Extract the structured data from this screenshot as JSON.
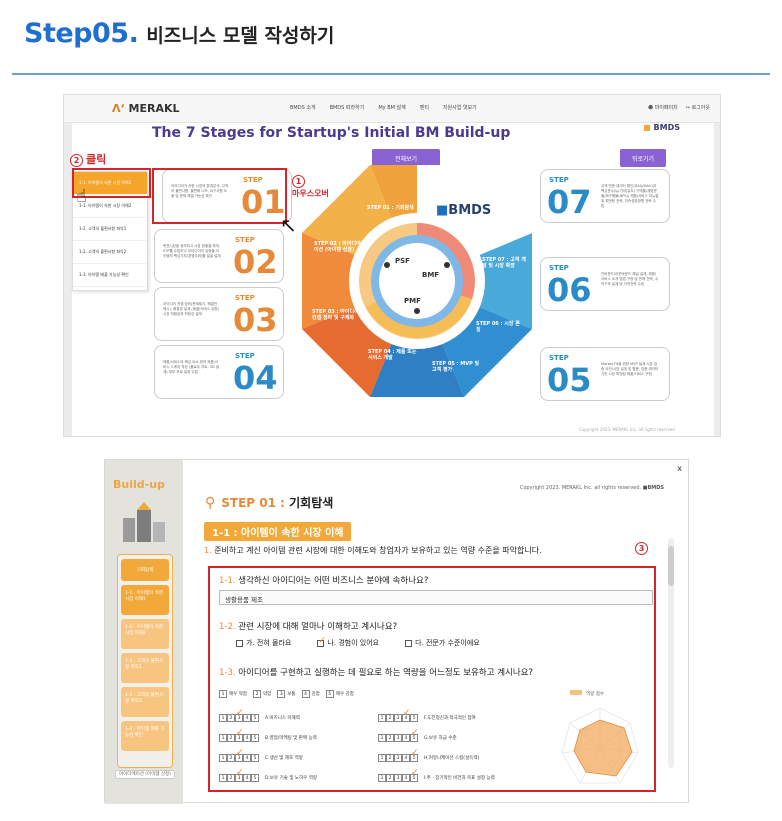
{
  "heading": {
    "step": "Step05.",
    "title": "비즈니스 모델 작성하기"
  },
  "shot1": {
    "logo": "MERAKL",
    "nav": [
      "BMDS 소개",
      "BMDS 따라하기",
      "My BM 설계",
      "멘티",
      "지원사업 엿보기"
    ],
    "nav_right": [
      "마이페이지",
      "로그아웃"
    ],
    "title": "The 7 Stages for Startup's Initial BM Build-up",
    "bmds_top": "BMDS",
    "btn_all": "전체보기",
    "btn_back": "뒤로가기",
    "click_num": "2",
    "click_text": "클릭",
    "side_items": [
      "1-1. 아이템이 속한 시장 이해1",
      "1-1. 아이템이 속한 시장 이해2",
      "1-2. 고객의 불편사항 파악1",
      "1-2. 고객의 불편사항 파악2",
      "1-3. 아이템 매출 가능성 확인"
    ],
    "mouse_num": "1",
    "mouse_text": "마우스오버",
    "cards": [
      {
        "step": "STEP",
        "num": "01",
        "text": "아이디어가 속한 시장의 환경분석, 고객의 불편사항, 불편해 니즈, 요구사항 도출 및 문제 해결 가능성 확인"
      },
      {
        "step": "STEP",
        "num": "02",
        "text": "목표시장을 정의하고 시장 현황을 파악, STP를 수립하고 아이디어의 검증을 아이템의 핵심가치(경쟁우위)를 발굴 설계"
      },
      {
        "step": "STEP",
        "num": "03",
        "text": "아이디어 컨셉 정의(문제제기, 해결안 제시), 해결방 설계 (제품/서비스 유형) 시장 적합성과 적정성 설계"
      },
      {
        "step": "STEP",
        "num": "04",
        "text": "제품/서비스의 핵심 요소 정의 제품/서비스 스케치 작성 (플로우 차트, 3D 설계) 세부 프로 일정 수립"
      },
      {
        "step": "STEP",
        "num": "07",
        "text": "고객 반응 데이터 확인(DAU/MAU)과 핵심운수/뉴/기여(유도) 구매율(재방문율/재구매율(NPS)) 제품/서비스 리뉴얼 및 피벗팅 전략, 지속성장방향 전략 수립"
      },
      {
        "step": "STEP",
        "num": "06",
        "text": "인바운드/아웃바운드 채널 설계, 채용/서비스 소개 방법 구현 및 판매 전략, 수익구조 설계 및 가격전략 수립"
      },
      {
        "step": "STEP",
        "num": "05",
        "text": "Market Fit을 위한 MVP 설계 시장 검증 사전/시장 설계 및 활용, 검증 데이터 기반 시장 피벗팅 제품/서비스 구현"
      }
    ],
    "stages": [
      "STEP 01 : 기회탐색",
      "STEP 02 : 아이디에이션 (아이템 선정)",
      "STEP 03 : 아이디어 컨셉 정의 및 구체화",
      "STEP 04 : 제품 또는 서비스 개발",
      "STEP 05 : MVP 및 고객 평가",
      "STEP 06 : 시장 론칭",
      "STEP 07 : 고객 개발 및 시장 확장"
    ],
    "ring": {
      "psf": "PSF",
      "bmf": "BMF",
      "pmf": "PMF"
    },
    "bmds_logo": "BMDS",
    "copyright": "Copyright 2023. MERAKL Inc. all rights reserved."
  },
  "shot2": {
    "build": "Build-up",
    "close": "x",
    "copyright": "Copyright 2023. MERAKL Inc. all rights reserved.",
    "copyright_logo": "BMDS",
    "left_nav": [
      "기회탐색",
      "1-1 : 아이템이 속한 시장 이해1",
      "1-1 : 아이템이 속한 시장 이해2",
      "1-2 : 고객의 불편사항 파악1",
      "1-2 : 고객의 불편사항 파악2",
      "1-3 : 아이템 매출 가능성 확인"
    ],
    "bottom_label": "아이디에이션 (아이템 선정)",
    "step_prefix": "STEP 01 :",
    "step_title": "기회탐색",
    "tag": "1-1 : 아이템이 속한 시장 이해",
    "intro_num": "1.",
    "intro_text": "준비하고 계신 아이템 관련 시장에 대한 이해도와 창업자가 보유하고 있는 역량 수준을 파악합니다.",
    "marker": "3",
    "q1_num": "1-1.",
    "q1": "생각하신 아이디어는 어떤 비즈니스 분야에 속하나요?",
    "a1": "생활용품 제조",
    "q2_num": "1-2.",
    "q2": "관련 시장에 대해 얼마나 이해하고 계시나요?",
    "q2_opts": [
      "가. 전혀 몰라요",
      "나. 경험이 있어요",
      "다. 전문가 수준이에요"
    ],
    "q3_num": "1-3.",
    "q3": "아이디어를 구현하고 실행하는 데 필요로 하는 역량을 어느정도 보유하고 계시나요?",
    "scale": [
      "매우 약함",
      "약함",
      "보통",
      "강함",
      "매우 강함"
    ],
    "rows_left": [
      "A.비즈니스 이해력",
      "B.영업/마케팅 및 판매 능력",
      "C.생산 및 제조 역량",
      "D.보유 기술 및 노하우 역량"
    ],
    "rows_right": [
      "F.도전정신과 적극적인 참여",
      "G.보유 자금 수준",
      "H.커뮤니케이션 스킬(설득력)",
      "I.추 · 장기적인 비전과 목표 설정 능력"
    ],
    "radar_legend": "역량 점수"
  }
}
